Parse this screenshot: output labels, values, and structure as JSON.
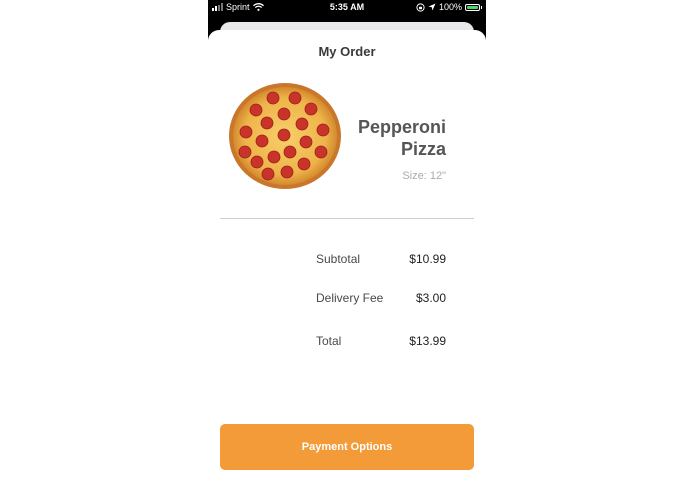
{
  "status_bar": {
    "carrier": "Sprint",
    "time": "5:35 AM",
    "battery_percent": "100%",
    "signal_bars": 4,
    "signal_bars_active": 2,
    "icons": [
      "signal-icon",
      "wifi-icon",
      "screen-lock-icon",
      "location-arrow-icon",
      "battery-icon"
    ]
  },
  "order": {
    "title": "My Order",
    "item": {
      "name": "Pepperoni Pizza",
      "size": "Size: 12\"",
      "image": "pizza-image"
    },
    "summary": [
      {
        "label": "Subtotal",
        "value": "$10.99"
      },
      {
        "label": "Delivery Fee",
        "value": "$3.00"
      },
      {
        "label": "Total",
        "value": "$13.99"
      }
    ]
  },
  "actions": {
    "payment_label": "Payment Options"
  },
  "colors": {
    "accent": "#F29B38",
    "status_bar_bg": "#000000",
    "battery": "#4CD964"
  }
}
